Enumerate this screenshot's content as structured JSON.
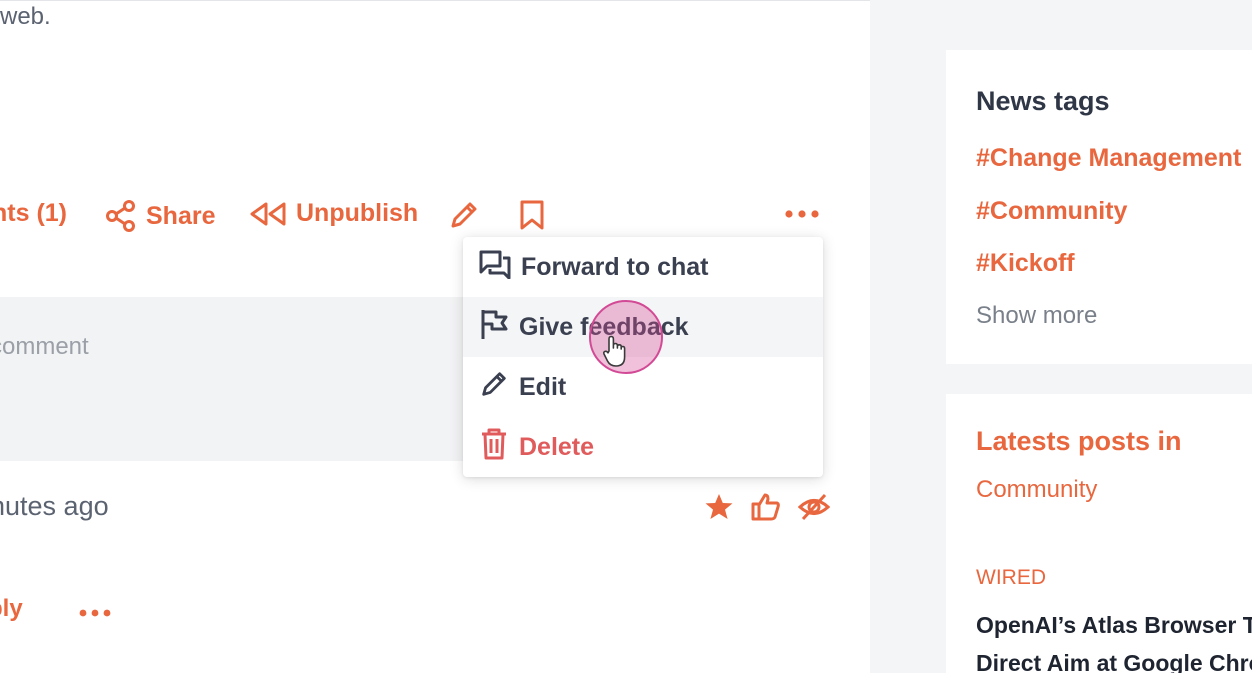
{
  "post": {
    "intro_tail": "web.",
    "actions": {
      "comments_label": "nts (1)",
      "share_label": "Share",
      "unpublish_label": "Unpublish"
    }
  },
  "menu": {
    "items": [
      {
        "label": "Forward to chat",
        "icon": "forward-chat-icon"
      },
      {
        "label": "Give feedback",
        "icon": "flag-icon"
      },
      {
        "label": "Edit",
        "icon": "pencil-icon"
      },
      {
        "label": "Delete",
        "icon": "trash-icon"
      }
    ]
  },
  "comment_input": {
    "placeholder": "comment"
  },
  "comment": {
    "meta": "nutes ago",
    "text": "!",
    "reply_label": "ply"
  },
  "sidebar": {
    "news_tags": {
      "title": "News tags",
      "tags": [
        "#Change Management",
        "#Community",
        "#Kickoff"
      ],
      "show_more": "Show more"
    },
    "latest_posts": {
      "title": "Latests posts in",
      "subtitle": "Community",
      "post": {
        "source": "WIRED",
        "title_line1": "OpenAI’s Atlas Browser Takes",
        "title_line2": "Direct Aim at Google Chrome"
      }
    }
  },
  "colors": {
    "accent": "#e8673e",
    "danger": "#e05c5c",
    "text_dark": "#2f3646",
    "cursor_highlight": "#d24a95"
  }
}
